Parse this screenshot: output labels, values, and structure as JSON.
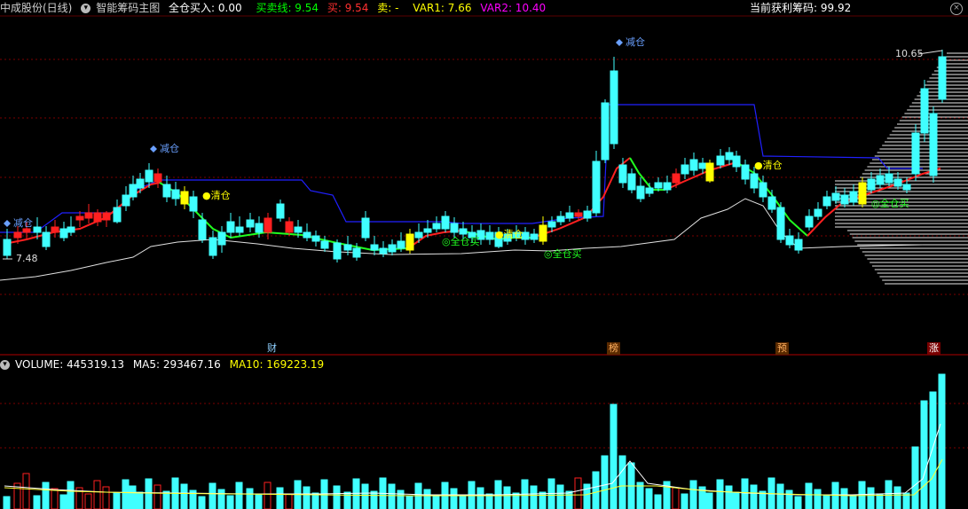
{
  "header": {
    "stock_name": "中成股份(日线)",
    "indicator_name": "智能筹码主图",
    "full_buy": "全仓买入: 0.00",
    "buy_sell_line": "买卖线: 9.54",
    "buy": "买: 9.54",
    "sell": "卖: -",
    "var1": "VAR1: 7.66",
    "var2": "VAR2: 10.40",
    "profit_chips": "当前获利筹码: 99.92"
  },
  "price_labels": {
    "high": "10.65",
    "low": "7.48"
  },
  "annotations": {
    "reduce": "减仓",
    "clear": "清仓",
    "full_buy": "全仓买"
  },
  "event_tags": [
    {
      "label": "财",
      "color": "#8fd0ff"
    },
    {
      "label": "榜",
      "color": "#ffb060"
    },
    {
      "label": "预",
      "color": "#ffb060"
    },
    {
      "label": "涨",
      "color": "#ffffff"
    }
  ],
  "volume_header": {
    "volume": "VOLUME: 445319.13",
    "ma5": "MA5: 293467.16",
    "ma10": "MA10: 169223.19"
  },
  "colors": {
    "up": "#ff2020",
    "down": "#40ffff",
    "signal": "#ffff00",
    "support": "#2020ff",
    "ma_white": "#e0e0e0"
  }
}
